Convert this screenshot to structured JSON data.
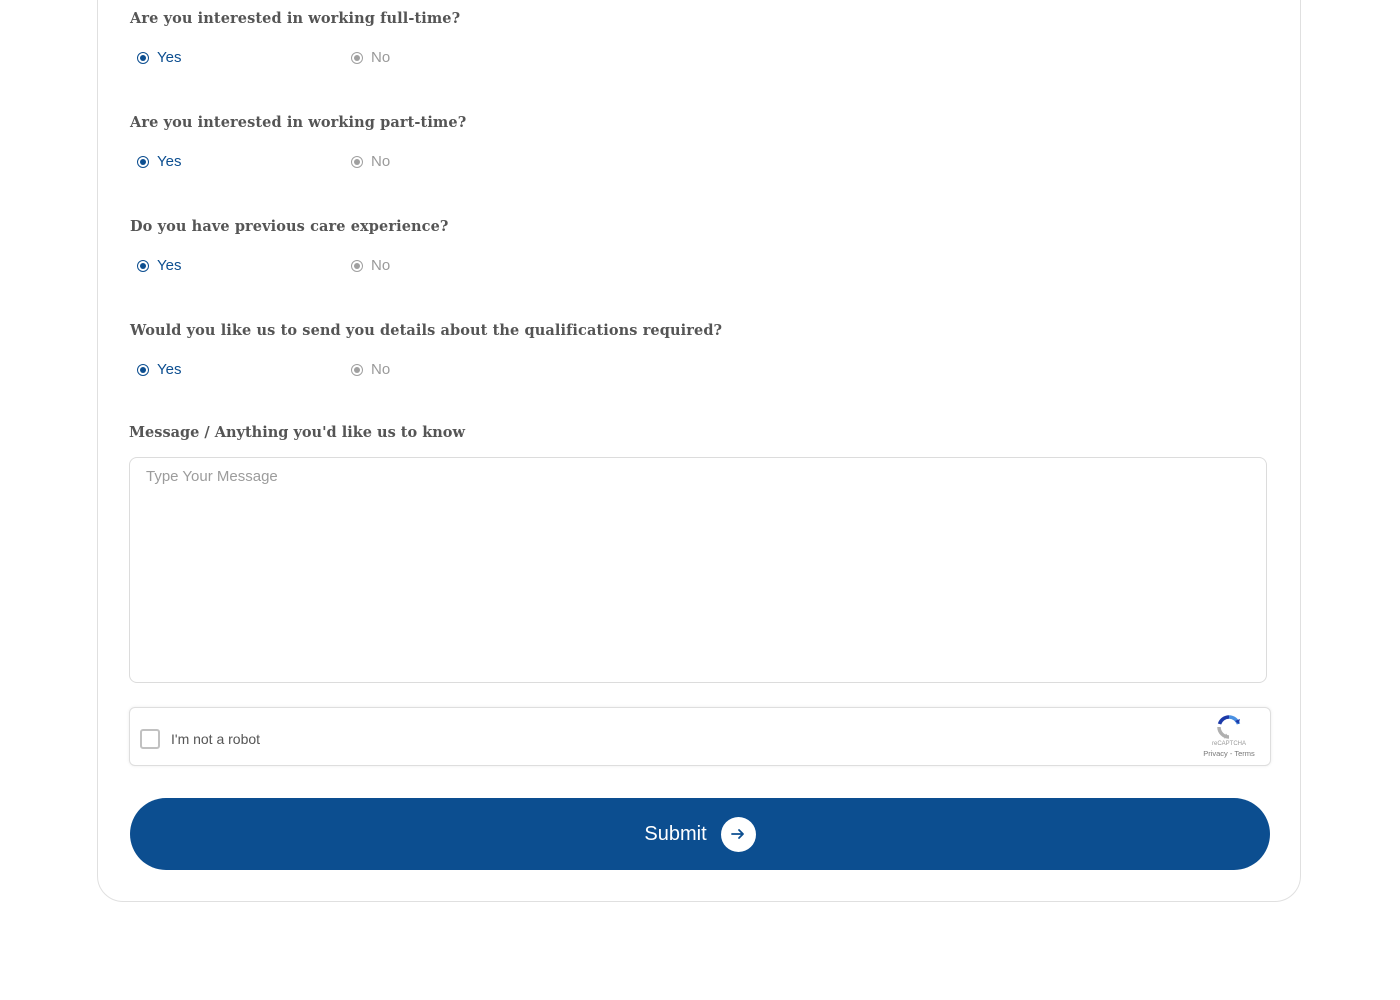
{
  "questions": [
    {
      "label": "Are you interested in working full-time?",
      "yes": "Yes",
      "no": "No",
      "selected": "Yes"
    },
    {
      "label": "Are you interested in working part-time?",
      "yes": "Yes",
      "no": "No",
      "selected": "Yes"
    },
    {
      "label": "Do you have previous care experience?",
      "yes": "Yes",
      "no": "No",
      "selected": "Yes"
    },
    {
      "label": "Would you like us to send you details about the qualifications required?",
      "yes": "Yes",
      "no": "No",
      "selected": "Yes"
    }
  ],
  "message": {
    "label": "Message / Anything you'd like us to know",
    "placeholder": "Type Your Message",
    "value": ""
  },
  "captcha": {
    "label": "I'm not a robot",
    "brand": "reCAPTCHA",
    "links": "Privacy - Terms",
    "checked": false
  },
  "submit": {
    "label": "Submit",
    "icon": "arrow-right-icon"
  },
  "colors": {
    "accent": "#0c4e90",
    "muted": "#9a9a9a",
    "border": "#dcdcdc"
  }
}
